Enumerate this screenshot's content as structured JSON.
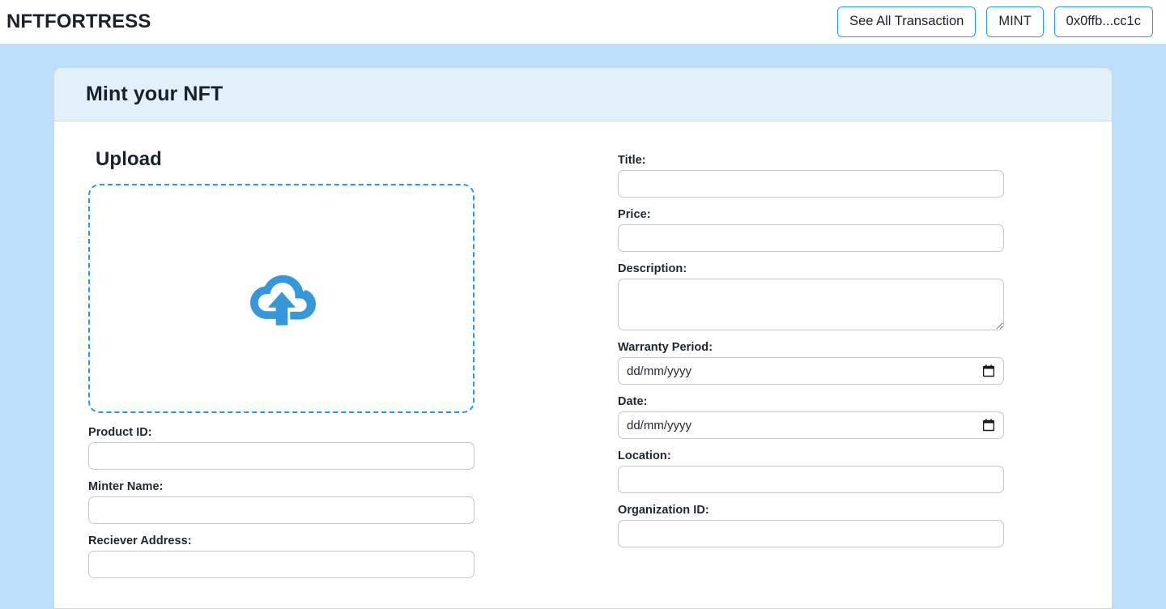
{
  "navbar": {
    "brand": "NFTFORTRESS",
    "buttons": [
      {
        "label": "See All Transaction",
        "name": "see-all-transaction-button"
      },
      {
        "label": "MINT",
        "name": "mint-button"
      },
      {
        "label": "0x0ffb...cc1c",
        "name": "wallet-address-button"
      }
    ]
  },
  "card": {
    "title": "Mint your NFT"
  },
  "upload": {
    "heading": "Upload",
    "icon": "cloud-upload-icon"
  },
  "form": {
    "left": [
      {
        "label": "Product ID:",
        "value": "",
        "placeholder": "",
        "type": "text",
        "name": "product-id"
      },
      {
        "label": "Minter Name:",
        "value": "",
        "placeholder": "",
        "type": "text",
        "name": "minter-name"
      },
      {
        "label": "Reciever Address:",
        "value": "",
        "placeholder": "",
        "type": "text",
        "name": "reciever-address"
      }
    ],
    "right": [
      {
        "label": "Title:",
        "value": "",
        "placeholder": "",
        "type": "text",
        "name": "title"
      },
      {
        "label": "Price:",
        "value": "",
        "placeholder": "",
        "type": "text",
        "name": "price"
      },
      {
        "label": "Description:",
        "value": "",
        "placeholder": "",
        "type": "textarea",
        "name": "description"
      },
      {
        "label": "Warranty Period:",
        "value": "",
        "placeholder": "dd/mm/yyyy",
        "type": "date",
        "name": "warranty-period"
      },
      {
        "label": "Date:",
        "value": "",
        "placeholder": "dd/mm/yyyy",
        "type": "date",
        "name": "date"
      },
      {
        "label": "Location:",
        "value": "",
        "placeholder": "",
        "type": "text",
        "name": "location"
      },
      {
        "label": "Organization ID:",
        "value": "",
        "placeholder": "",
        "type": "text",
        "name": "organization-id"
      }
    ]
  },
  "colors": {
    "page_background": "#bddffa",
    "accent_blue": "#2b9bf0",
    "card_header": "#e2f0f9",
    "cloud_icon": "#3498db",
    "text": "#1d2228"
  }
}
